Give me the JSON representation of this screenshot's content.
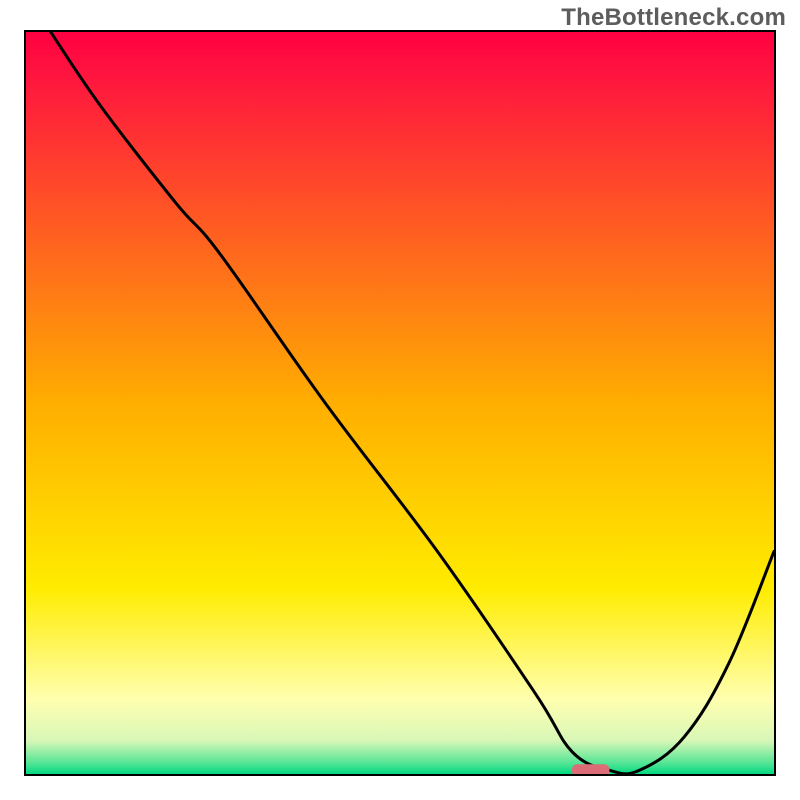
{
  "watermark": "TheBottleneck.com",
  "chart_data": {
    "type": "line",
    "title": "",
    "xlabel": "",
    "ylabel": "",
    "xlim": [
      0,
      100
    ],
    "ylim": [
      0,
      100
    ],
    "grid": false,
    "series": [
      {
        "name": "curve",
        "x": [
          3.3,
          10,
          20,
          26,
          40,
          55,
          68,
          73,
          78,
          82,
          88,
          94,
          100
        ],
        "y": [
          100,
          90,
          77,
          70,
          50,
          30,
          11,
          3,
          0.5,
          0.5,
          5,
          15,
          30
        ]
      }
    ],
    "marker": {
      "x_start": 73,
      "x_end": 78,
      "y": 0.5,
      "color": "#dc6c76"
    },
    "background": {
      "type": "vertical-gradient",
      "stops": [
        {
          "pos": 0.0,
          "color": "#ff0040"
        },
        {
          "pos": 0.05,
          "color": "#ff1240"
        },
        {
          "pos": 0.5,
          "color": "#ffae00"
        },
        {
          "pos": 0.75,
          "color": "#ffec00"
        },
        {
          "pos": 0.9,
          "color": "#ffffb0"
        },
        {
          "pos": 0.955,
          "color": "#d8f7b7"
        },
        {
          "pos": 0.985,
          "color": "#55e596"
        },
        {
          "pos": 1.0,
          "color": "#00d980"
        }
      ]
    }
  }
}
